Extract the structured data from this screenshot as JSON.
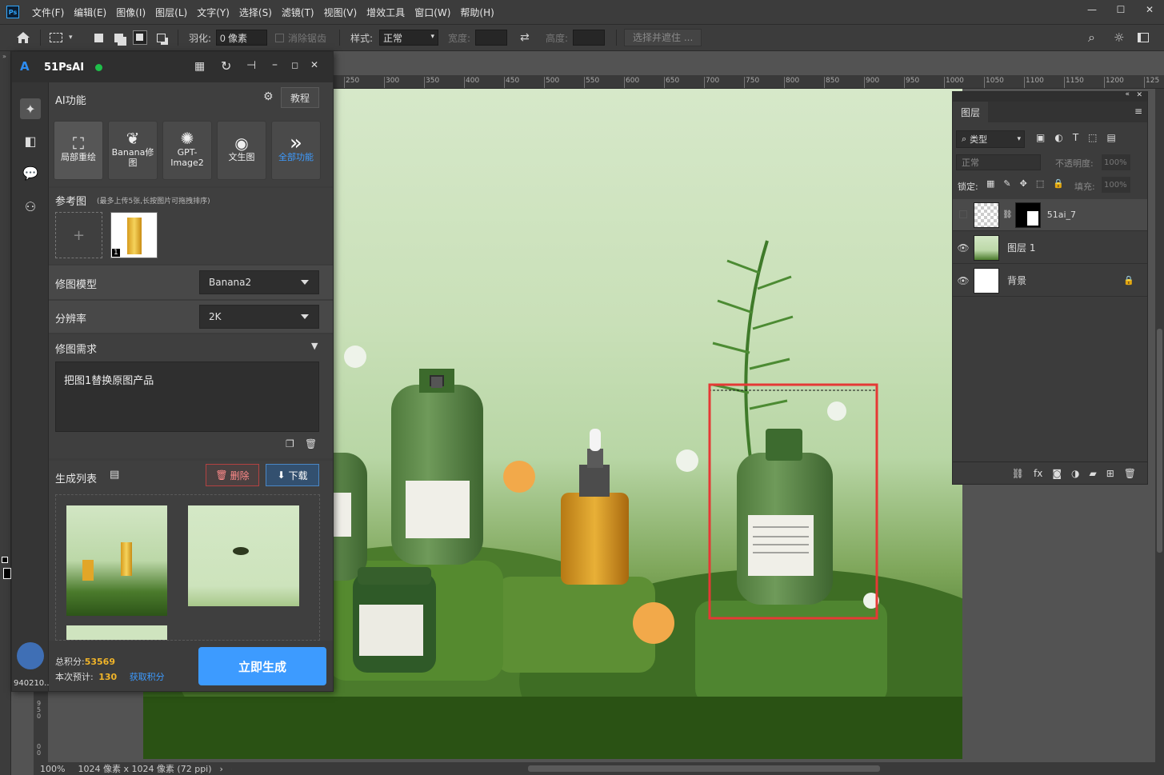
{
  "menubar": {
    "logo": "Ps",
    "items": [
      "文件(F)",
      "编辑(E)",
      "图像(I)",
      "图层(L)",
      "文字(Y)",
      "选择(S)",
      "滤镜(T)",
      "视图(V)",
      "增效工具",
      "窗口(W)",
      "帮助(H)"
    ]
  },
  "options": {
    "feather_label": "羽化:",
    "feather_value": "0 像素",
    "antialias_label": "消除锯齿",
    "style_label": "样式:",
    "style_value": "正常",
    "width_label": "宽度:",
    "height_label": "高度:",
    "select_mask_button": "选择并遮住 ..."
  },
  "ruler": {
    "ticks": [
      "250",
      "300",
      "350",
      "400",
      "450",
      "500",
      "550",
      "600",
      "650",
      "700",
      "750",
      "800",
      "850",
      "900",
      "950",
      "1000",
      "1050",
      "1100",
      "1150",
      "1200",
      "125"
    ]
  },
  "plugin": {
    "title": "51PsAI",
    "ai_section_title": "AI功能",
    "tutorial_button": "教程",
    "functions": [
      {
        "label": "局部重绘",
        "icon": "⛶"
      },
      {
        "label": "Banana修图",
        "icon": "🍌"
      },
      {
        "label": "GPT-Image2",
        "icon": "⚙"
      },
      {
        "label": "文生图",
        "icon": "🎨"
      },
      {
        "label": "全部功能",
        "icon": "»"
      }
    ],
    "reference": {
      "title": "参考图",
      "hint": "(最多上传5张,长按图片可拖拽排序)",
      "add_symbol": "+",
      "thumb_index": "1"
    },
    "model": {
      "label": "修图模型",
      "value": "Banana2"
    },
    "resolution": {
      "label": "分辨率",
      "value": "2K"
    },
    "prompt": {
      "label": "修图需求",
      "value": "把图1替换原图产品"
    },
    "generation": {
      "title": "生成列表",
      "delete_button": "删除",
      "download_button": "下载"
    },
    "points": {
      "total_label": "总积分:",
      "total_value": "53569",
      "estimate_label": "本次预计:",
      "estimate_value": "130",
      "get_points_link": "获取积分"
    },
    "generate_button": "立即生成",
    "user_id": "940210..."
  },
  "layers_panel": {
    "tab": "图层",
    "filter_value": "类型",
    "blend_mode": "正常",
    "opacity_label": "不透明度:",
    "opacity_value": "100%",
    "lock_label": "锁定:",
    "fill_label": "填充:",
    "fill_value": "100%",
    "layers": [
      {
        "name": "51ai_7",
        "visible": false
      },
      {
        "name": "图层 1",
        "visible": true
      },
      {
        "name": "背景",
        "visible": true
      }
    ]
  },
  "status": {
    "zoom": "100%",
    "doc_size": "1024 像素 x 1024 像素 (72 ppi)"
  },
  "left_ruler_ticks": [
    "9",
    "5",
    "0",
    "0",
    "0"
  ]
}
